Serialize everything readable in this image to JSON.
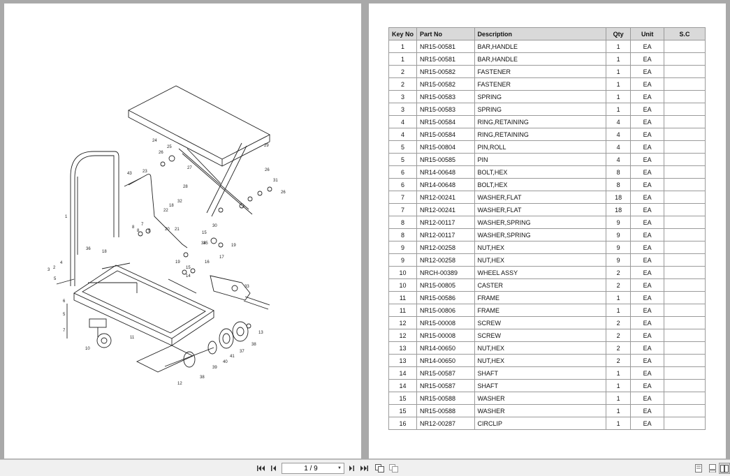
{
  "viewer": {
    "page_indicator": "1 / 9",
    "buttons": {
      "first": "first-page-icon",
      "prev": "previous-page-icon",
      "next": "next-page-icon",
      "last": "last-page-icon",
      "copy": "copy-icon",
      "copy2": "duplicate-icon",
      "view_single": "single-page-view-icon",
      "view_continuous": "continuous-view-icon",
      "view_two_page": "two-page-view-icon"
    }
  },
  "drawing_labels": [
    "24",
    "25",
    "26",
    "27",
    "29",
    "26",
    "31",
    "26",
    "28",
    "32",
    "18",
    "43",
    "23",
    "22",
    "20",
    "21",
    "15",
    "30",
    "35",
    "19",
    "8",
    "7",
    "8",
    "9",
    "34",
    "17",
    "36",
    "18",
    "1",
    "19",
    "16",
    "15",
    "14",
    "4",
    "2",
    "3",
    "5",
    "6",
    "5",
    "7",
    "33",
    "10",
    "11",
    "13",
    "38",
    "37",
    "41",
    "40",
    "39",
    "12",
    "38"
  ],
  "parts_table": {
    "headers": [
      "Key No",
      "Part No",
      "Description",
      "Qty",
      "Unit",
      "S.C"
    ],
    "rows": [
      [
        "1",
        "NR15-00581",
        "BAR,HANDLE",
        "1",
        "EA",
        ""
      ],
      [
        "1",
        "NR15-00581",
        "BAR,HANDLE",
        "1",
        "EA",
        ""
      ],
      [
        "2",
        "NR15-00582",
        "FASTENER",
        "1",
        "EA",
        ""
      ],
      [
        "2",
        "NR15-00582",
        "FASTENER",
        "1",
        "EA",
        ""
      ],
      [
        "3",
        "NR15-00583",
        "SPRING",
        "1",
        "EA",
        ""
      ],
      [
        "3",
        "NR15-00583",
        "SPRING",
        "1",
        "EA",
        ""
      ],
      [
        "4",
        "NR15-00584",
        "RING,RETAINING",
        "4",
        "EA",
        ""
      ],
      [
        "4",
        "NR15-00584",
        "RING,RETAINING",
        "4",
        "EA",
        ""
      ],
      [
        "5",
        "NR15-00804",
        "PIN,ROLL",
        "4",
        "EA",
        ""
      ],
      [
        "5",
        "NR15-00585",
        "PIN",
        "4",
        "EA",
        ""
      ],
      [
        "6",
        "NR14-00648",
        "BOLT,HEX",
        "8",
        "EA",
        ""
      ],
      [
        "6",
        "NR14-00648",
        "BOLT,HEX",
        "8",
        "EA",
        ""
      ],
      [
        "7",
        "NR12-00241",
        "WASHER,FLAT",
        "18",
        "EA",
        ""
      ],
      [
        "7",
        "NR12-00241",
        "WASHER,FLAT",
        "18",
        "EA",
        ""
      ],
      [
        "8",
        "NR12-00117",
        "WASHER,SPRING",
        "9",
        "EA",
        ""
      ],
      [
        "8",
        "NR12-00117",
        "WASHER,SPRING",
        "9",
        "EA",
        ""
      ],
      [
        "9",
        "NR12-00258",
        "NUT,HEX",
        "9",
        "EA",
        ""
      ],
      [
        "9",
        "NR12-00258",
        "NUT,HEX",
        "9",
        "EA",
        ""
      ],
      [
        "10",
        "NRCH-00389",
        "WHEEL ASSY",
        "2",
        "EA",
        ""
      ],
      [
        "10",
        "NR15-00805",
        "CASTER",
        "2",
        "EA",
        ""
      ],
      [
        "11",
        "NR15-00586",
        "FRAME",
        "1",
        "EA",
        ""
      ],
      [
        "11",
        "NR15-00806",
        "FRAME",
        "1",
        "EA",
        ""
      ],
      [
        "12",
        "NR15-00008",
        "SCREW",
        "2",
        "EA",
        ""
      ],
      [
        "12",
        "NR15-00008",
        "SCREW",
        "2",
        "EA",
        ""
      ],
      [
        "13",
        "NR14-00650",
        "NUT,HEX",
        "2",
        "EA",
        ""
      ],
      [
        "13",
        "NR14-00650",
        "NUT,HEX",
        "2",
        "EA",
        ""
      ],
      [
        "14",
        "NR15-00587",
        "SHAFT",
        "1",
        "EA",
        ""
      ],
      [
        "14",
        "NR15-00587",
        "SHAFT",
        "1",
        "EA",
        ""
      ],
      [
        "15",
        "NR15-00588",
        "WASHER",
        "1",
        "EA",
        ""
      ],
      [
        "15",
        "NR15-00588",
        "WASHER",
        "1",
        "EA",
        ""
      ],
      [
        "16",
        "NR12-00287",
        "CIRCLIP",
        "1",
        "EA",
        ""
      ]
    ]
  }
}
